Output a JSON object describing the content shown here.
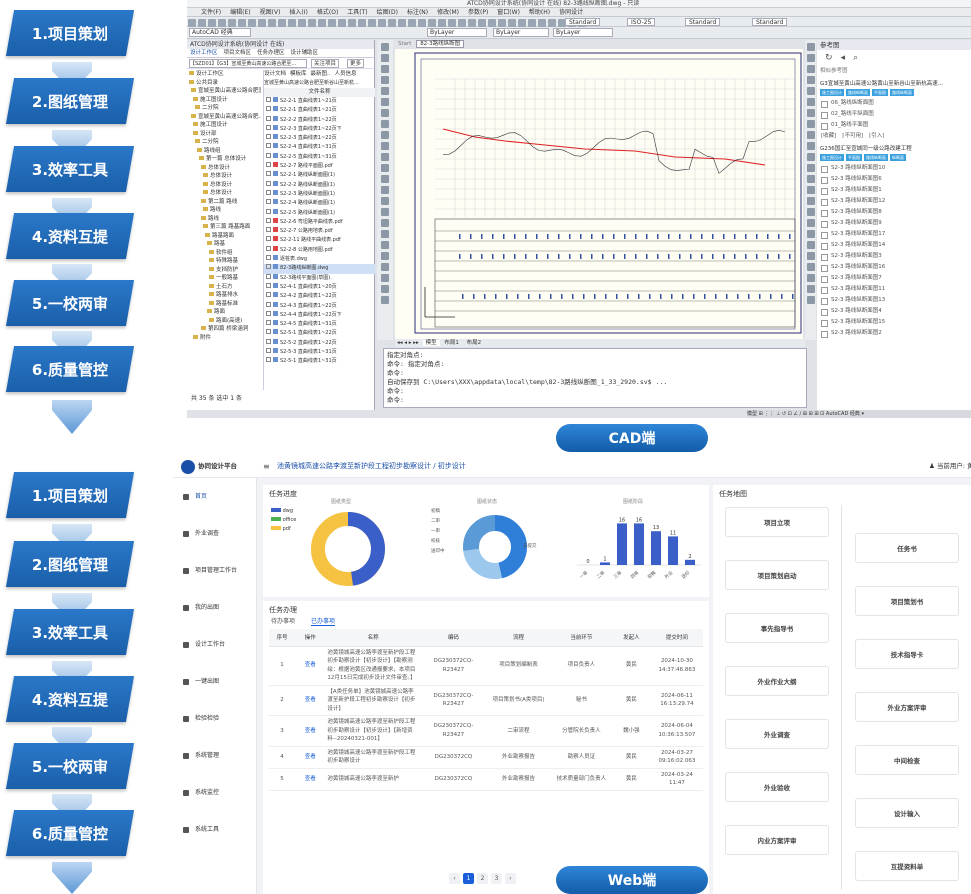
{
  "steps": [
    "1.项目策划",
    "2.图纸管理",
    "3.效率工具",
    "4.资料互提",
    "5.一校两审",
    "6.质量管控"
  ],
  "labels": {
    "cad": "CAD端",
    "web": "Web端"
  },
  "cad": {
    "title": "ATCD协同设计系统(协同设计 在线)    82-3路线纵断图.dwg - 只读",
    "menu": [
      "文件(F)",
      "编辑(E)",
      "视图(V)",
      "插入(I)",
      "格式(O)",
      "工具(T)",
      "绘图(D)",
      "标注(N)",
      "修改(M)",
      "参数(P)",
      "窗口(W)",
      "帮助(H)",
      "协同设计"
    ],
    "workspace": "AutoCAD 经典",
    "layer": "ByLayer",
    "std": [
      "Standard",
      "ISO-25",
      "Standard",
      "Standard"
    ],
    "panel_title": "ATCD协同设计系统(协同设计 在线)",
    "panel_tabs": [
      "设计工作区",
      "项目文档区",
      "任务办理区",
      "设计辅助区"
    ],
    "project": "【SZD01】【G3】宣城至黄山高速公路合肥至...",
    "project_btn": "关注项目",
    "more": "更多",
    "left_tree": [
      "设计工作区",
      "公共目录",
      "宣城至黄山高速公路合肥宣...",
      "施工图设计",
      "二分院",
      "宣城至黄山高速公路合肥...",
      "施工图设计",
      "设计部",
      "二分院",
      "路线组",
      "第一篇 总体设计",
      "总体设计",
      "总体设计",
      "总体设计",
      "总体设计",
      "第二篇 路线",
      "路线",
      "路线",
      "第三篇 路基路面",
      "路基路面",
      "路基",
      "软件组",
      "特殊路基",
      "支挡防护",
      "一般路基",
      "土石方",
      "路基排水",
      "路基标准",
      "路面",
      "路面(高速)",
      "第四篇 桥梁涵洞",
      "附件"
    ],
    "file_tabs": [
      "设计文档",
      "模板库",
      "最新图..",
      "人员信息"
    ],
    "file_header": "文件名称",
    "file_path": "宣城至黄山高速公路合肥至新谷山至新杭...",
    "files": [
      "S2-2-1 直曲线表1~21页",
      "S2-2-1 直曲线表1~21页",
      "S2-2-2 直曲线表1~22页",
      "S2-2-3 直曲线表1~22页下",
      "S2-2-3 直曲线表1~22页",
      "S2-2-4 直曲线表1~31页",
      "S2-2-5 直曲线表1~31页",
      "S2-2-7 路线平面图.pdf",
      "S2-2-1 路线纵断面图(1)",
      "S2-2-2 路线纵断面图(1)",
      "S2-2-3 路线纵断面图(1)",
      "S2-2-4 路线纵断面图(1)",
      "S2-2-5 路线纵断面图(1)",
      "S2-2-6 弯坦路平曲线表.pdf",
      "S2-2-7 公路用地表.pdf",
      "S2-2-11 路线平曲线表.pdf",
      "S2-2-8 公路用地图.pdf",
      "逐桩表.dwg",
      "82-3路线纵断图.dwg",
      "S2-3路线平面图(草图).",
      "S2-4-1 直曲线表1~20页",
      "S2-4-2 直曲线表1~22页",
      "S2-4-3 直曲线表1~22页",
      "S2-4-4 直曲线表1~22页下",
      "S2-4-5 直曲线表1~31页",
      "S2-5-1 直曲线表1~22页",
      "S2-5-2 直曲线表1~22页",
      "S2-5-3 直曲线表1~31页",
      "S2-5-1 直曲线表1~31页"
    ],
    "status_left": "共 35 条   选中 1 条",
    "draw_tabs": [
      "Start",
      "82-3路线纵断图"
    ],
    "model_tabs": [
      "模型",
      "布局1",
      "布局2"
    ],
    "cmd_lines": [
      "指定对角点:",
      "命令: 指定对角点:",
      "命令:",
      "自动保存到 C:\\Users\\XXX\\appdata\\local\\temp\\82-3路线纵断图_1_33_2920.sv$ ...",
      "命令:",
      "命令:"
    ],
    "right_title": "参考图",
    "right_sub": "相似参考图",
    "right_proj1": "G3宣城至黄山高速公路黄山至新谷山至新杭高速... ",
    "right_tags1": [
      "施工图设计",
      "路线纵断面",
      "平面图",
      "路线纵断面"
    ],
    "right_items1": [
      "06_路线纵断面图",
      "02_路线平纵面图",
      "01_路线平面图"
    ],
    "right_links": [
      "[收藏]",
      "[不可用]",
      "[引入]"
    ],
    "right_proj2": "G236国汇至宣城同一级公路改建工程",
    "right_tags2": [
      "施工图设计",
      "平面图",
      "路线纵断面",
      "纵断面"
    ],
    "right_items2": [
      "S2-3 路线纵断面图10",
      "S2-3 路线纵断面图6",
      "S2-3 路线纵断面图1",
      "S2-3 路线纵断面图12",
      "S2-3 路线纵断面图8",
      "S2-3 路线纵断面图9",
      "S2-3 路线纵断面图17",
      "S2-3 路线纵断面图14",
      "S2-3 路线纵断面图3",
      "S2-3 路线纵断面图16",
      "S2-3 路线纵断面图7",
      "S2-3 路线纵断面图11",
      "S2-3 路线纵断面图13",
      "S2-3 路线纵断面图4",
      "S2-3 路线纵断面图15",
      "S2-3 路线纵断面图2"
    ],
    "status_bottom": "模型  ⊞  ⋮⋮  ⊥  ↺  ⊡  ∠  ∕  ⊞  ⊞  ⊞  ⊡   AutoCAD 经典 ▾"
  },
  "web": {
    "logo": "协同设计平台",
    "breadcrumb": "池黄镜城高速公路李渡至新护段工程初步勘察设计 / 初步设计",
    "user": "当前用户: 黄",
    "menu": [
      "首页",
      "外业调查",
      "项目管理工作台",
      "我的出图",
      "设计工作台",
      "一键出图",
      "检验检验",
      "系统管理",
      "系统监控",
      "系统工具"
    ],
    "progress_title": "任务进度",
    "chart_titles": [
      "图纸类型",
      "图纸状态",
      "图纸阶段"
    ],
    "legend": [
      "dwg",
      "office",
      "pdf"
    ],
    "donut_labels": [
      "初稿",
      "二审",
      "一审",
      "校核",
      "送印中"
    ],
    "donut_center": "未提交",
    "bar_values": [
      "0",
      "1",
      "16",
      "16",
      "13",
      "11",
      "2"
    ],
    "bar_cats": [
      "一审",
      "二审",
      "三审",
      "四审",
      "初稿",
      "外业",
      "送印"
    ],
    "handle_title": "任务办理",
    "handle_tabs": [
      "待办事项",
      "已办事项"
    ],
    "table_headers": [
      "序号",
      "操作",
      "名称",
      "编码",
      "流程",
      "当前环节",
      "发起人",
      "提交时间"
    ],
    "rows": [
      [
        "1",
        "查看",
        "池黄镜城高速公路李渡至新护段工程初步勘察设计【初步设计】【勘察测绘：根据池黄区改通报要求，本项目12月15日完成初步设计文件审查。】",
        "DG230372CQ-R23427",
        "项目策划编制表",
        "项目负责人",
        "黄民",
        "2024-10-30 14:37:46.863"
      ],
      [
        "2",
        "查看",
        "【A类任务单】池黄镜城高速公路李渡至新护段工程初步勘察设计【初步设计】",
        "DG230372CQ-R23427",
        "项目策划书(A类项目)",
        "秘书",
        "黄民",
        "2024-06-11 16:13:29.74"
      ],
      [
        "3",
        "查看",
        "池黄镜城高速公路李渡至新护段工程初步勘察设计【初步设计】【新增资料--20240321-001】",
        "DG230372CQ-R23427",
        "二审流程",
        "分管院长负责人",
        "魏小强",
        "2024-06-04 10:36:13.507"
      ],
      [
        "4",
        "查看",
        "池黄镜城高速公路李渡至新护段工程初步勘察设计",
        "DG230372CQ",
        "外业勘察报告",
        "勘察人员证",
        "黄民",
        "2024-03-27 09:16:02.063"
      ],
      [
        "5",
        "查看",
        "池黄镜城高速公路李渡至新护",
        "DG230372CQ",
        "外业勘察报告",
        "技术质量部门负责人",
        "黄民",
        "2024-03-24 11:47"
      ]
    ],
    "pages": [
      "‹",
      "1",
      "2",
      "3",
      "›"
    ],
    "map_title": "任务地图",
    "map_left": [
      "项目立项",
      "项目策划启动",
      "事先指导书",
      "外业作业大纲",
      "外业调查",
      "外业验收",
      "内业方案评审"
    ],
    "map_right": [
      "任务书",
      "项目策划书",
      "技术指导卡",
      "外业方案评审",
      "中间检查",
      "设计输入",
      "互提资料单"
    ]
  }
}
